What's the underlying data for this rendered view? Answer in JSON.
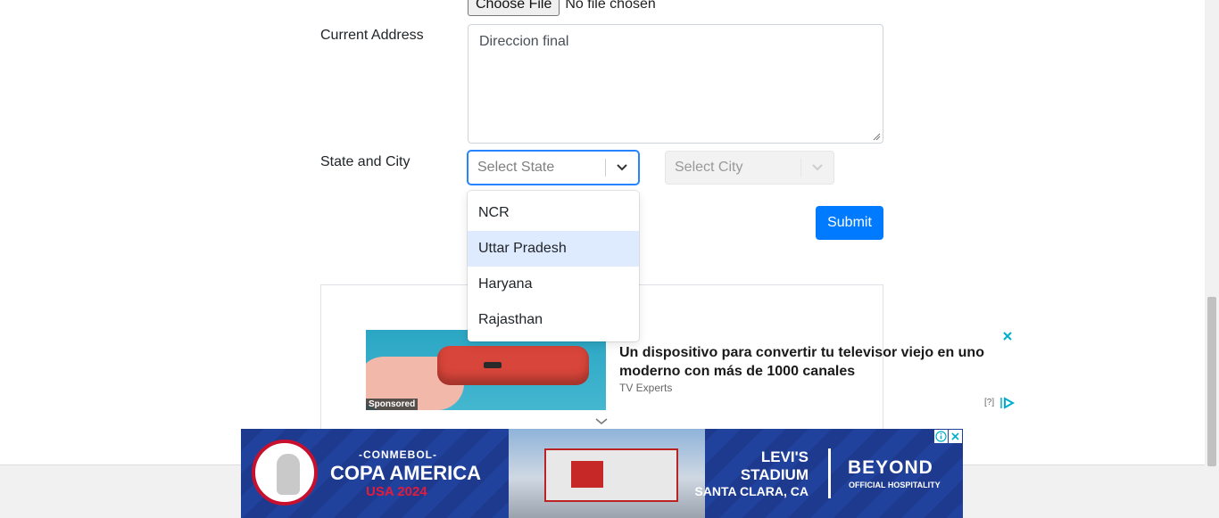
{
  "form": {
    "file_button_label": "Choose File",
    "file_status": "No file chosen",
    "current_address_label": "Current Address",
    "current_address_value": "Direccion final",
    "state_city_label": "State and City",
    "state_placeholder": "Select State",
    "city_placeholder": "Select City",
    "submit_label": "Submit"
  },
  "state_menu": {
    "options": [
      {
        "label": "NCR"
      },
      {
        "label": "Uttar Pradesh",
        "focused": true
      },
      {
        "label": "Haryana"
      },
      {
        "label": "Rajasthan"
      }
    ]
  },
  "native_ad": {
    "sponsored_label": "Sponsored",
    "headline": "Un dispositivo para convertir tu televisor viejo en uno moderno con más de 1000 canales",
    "brand": "TV Experts",
    "question_label": "[?]"
  },
  "banner_ad": {
    "conmebol": "-CONMEBOL-",
    "copa": "COPA AMERICA",
    "usa": "USA 2024",
    "levis_line1": "LEVI'S",
    "levis_line2": "STADIUM",
    "location": "SANTA CLARA, CA",
    "beyond": "BEYOND",
    "hospitality": "OFFICIAL HOSPITALITY"
  },
  "colors": {
    "primary": "#007bff",
    "select_focus": "#2684ff",
    "option_focus": "#deebff",
    "ad_close": "#00aecd"
  }
}
